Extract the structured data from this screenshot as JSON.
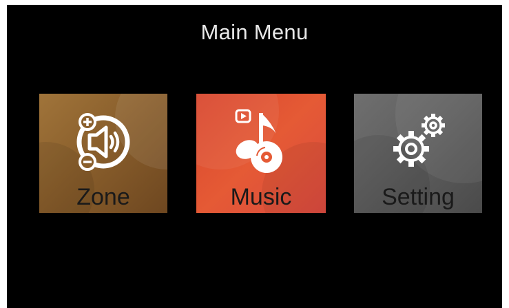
{
  "header": {
    "title": "Main Menu"
  },
  "menu": {
    "items": [
      {
        "label": "Zone",
        "icon": "speaker-volume-icon",
        "color": "#8a5f2c"
      },
      {
        "label": "Music",
        "icon": "music-note-disc-icon",
        "color": "#e55a35"
      },
      {
        "label": "Setting",
        "icon": "gears-icon",
        "color": "#5e5e5e"
      }
    ]
  }
}
